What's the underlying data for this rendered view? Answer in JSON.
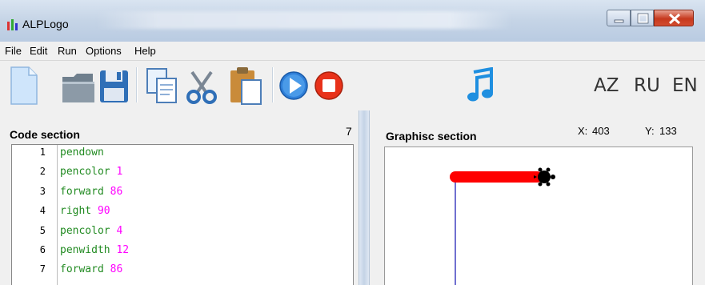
{
  "window": {
    "title": "ALPLogo"
  },
  "menu": {
    "items": [
      "File",
      "Edit",
      "Run",
      "Options",
      "Help"
    ]
  },
  "toolbar": {
    "icons": [
      "new-file-icon",
      "open-folder-icon",
      "save-icon",
      "copy-icon",
      "cut-icon",
      "paste-icon",
      "run-icon",
      "stop-icon",
      "music-icon"
    ],
    "languages": [
      "AZ",
      "RU",
      "EN"
    ]
  },
  "code_section": {
    "title": "Code section",
    "line_count": "7",
    "lines": [
      {
        "number": "1",
        "command": "pendown",
        "arg": ""
      },
      {
        "number": "2",
        "command": "pencolor",
        "arg": "1"
      },
      {
        "number": "3",
        "command": "forward",
        "arg": "86"
      },
      {
        "number": "4",
        "command": "right",
        "arg": "90"
      },
      {
        "number": "5",
        "command": "pencolor",
        "arg": "4"
      },
      {
        "number": "6",
        "command": "penwidth",
        "arg": "12"
      },
      {
        "number": "7",
        "command": "forward",
        "arg": "86"
      }
    ]
  },
  "graphics_section": {
    "title": "Graphisc section",
    "x_label": "X:",
    "x_value": "403",
    "y_label": "Y:",
    "y_value": "133"
  },
  "colors": {
    "code_command": "#228b22",
    "code_number": "#ff00ff",
    "line_color_1": "#4040c0",
    "line_color_4": "#ff0000",
    "stop_button": "#e8321a",
    "run_button": "#2f7fd8",
    "music_note": "#1f8fe0"
  }
}
